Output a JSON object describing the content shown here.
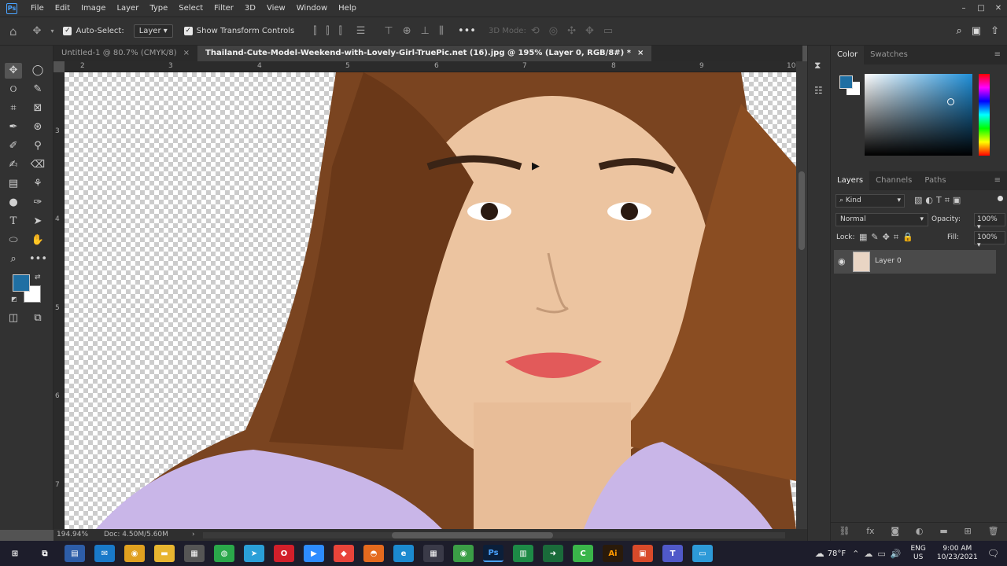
{
  "app": {
    "logo": "Ps",
    "menu": [
      "File",
      "Edit",
      "Image",
      "Layer",
      "Type",
      "Select",
      "Filter",
      "3D",
      "View",
      "Window",
      "Help"
    ],
    "window_controls": [
      "–",
      "□",
      "✕"
    ]
  },
  "options": {
    "auto_select": "Auto-Select:",
    "layer_dropdown": "Layer",
    "show_transform": "Show Transform Controls",
    "mode3d": "3D Mode:"
  },
  "tabs": [
    {
      "label": "Untitled-1 @ 80.7% (CMYK/8)",
      "close": "×"
    },
    {
      "label": "Thailand-Cute-Model-Weekend-with-Lovely-Girl-TruePic.net (16).jpg @ 195% (Layer 0, RGB/8#) *",
      "close": "×"
    }
  ],
  "ruler_h": [
    "2",
    "3",
    "4",
    "5",
    "6",
    "7",
    "8",
    "9",
    "10"
  ],
  "ruler_v": [
    "3",
    "4",
    "5",
    "6",
    "7"
  ],
  "status": {
    "zoom": "194.94%",
    "doc": "Doc: 4.50M/5.60M"
  },
  "color_panel": {
    "tabs": [
      "Color",
      "Swatches"
    ],
    "fg": "#1f6fa3",
    "bg": "#ffffff"
  },
  "layers_panel": {
    "tabs": [
      "Layers",
      "Channels",
      "Paths"
    ],
    "kind": "Kind",
    "blend": "Normal",
    "opacity_label": "Opacity:",
    "opacity": "100%",
    "lock_label": "Lock:",
    "fill_label": "Fill:",
    "fill": "100%",
    "layers": [
      {
        "name": "Layer 0",
        "visible": true
      }
    ]
  },
  "taskbar": {
    "weather": "78°F",
    "lang1": "ENG",
    "lang2": "US",
    "time": "9:00 AM",
    "date": "10/23/2021"
  }
}
